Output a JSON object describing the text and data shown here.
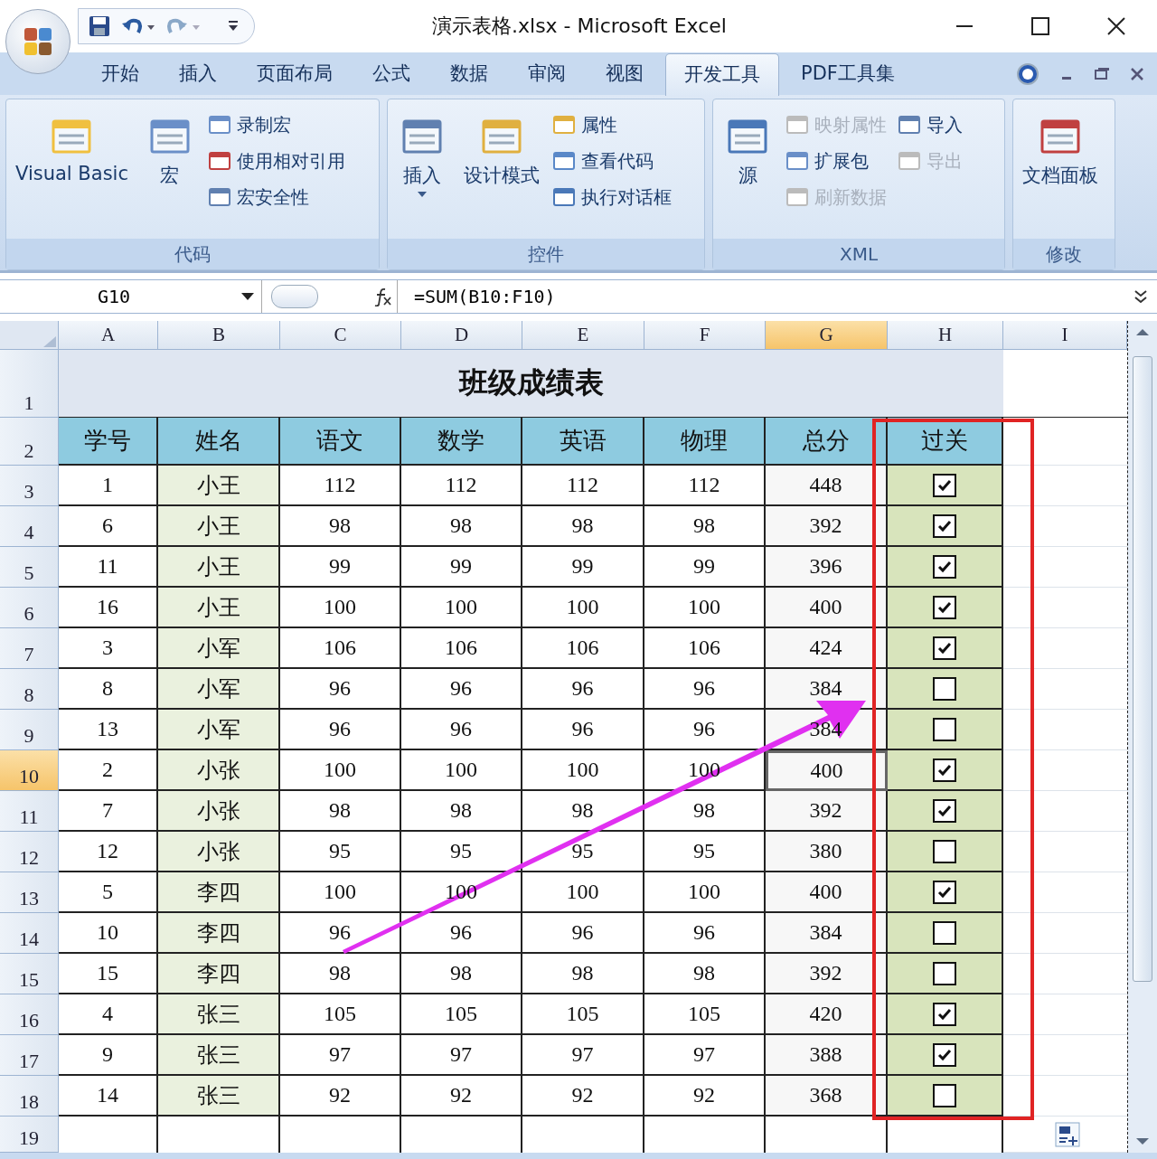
{
  "window": {
    "title": "演示表格.xlsx - Microsoft Excel"
  },
  "tabs": [
    {
      "label": "开始",
      "selected": false
    },
    {
      "label": "插入",
      "selected": false
    },
    {
      "label": "页面布局",
      "selected": false
    },
    {
      "label": "公式",
      "selected": false
    },
    {
      "label": "数据",
      "selected": false
    },
    {
      "label": "审阅",
      "selected": false
    },
    {
      "label": "视图",
      "selected": false
    },
    {
      "label": "开发工具",
      "selected": true
    },
    {
      "label": "PDF工具集",
      "selected": false
    }
  ],
  "ribbon_groups": [
    {
      "label": "代码",
      "large": [
        {
          "label": "Visual Basic",
          "dropdown": false
        },
        {
          "label": "宏",
          "dropdown": false
        }
      ],
      "small": [
        {
          "label": "录制宏",
          "disabled": false
        },
        {
          "label": "使用相对引用",
          "disabled": false
        },
        {
          "label": "宏安全性",
          "disabled": false
        }
      ]
    },
    {
      "label": "控件",
      "large": [
        {
          "label": "插入",
          "dropdown": true
        },
        {
          "label": "设计模式",
          "dropdown": false
        }
      ],
      "small": [
        {
          "label": "属性",
          "disabled": false
        },
        {
          "label": "查看代码",
          "disabled": false
        },
        {
          "label": "执行对话框",
          "disabled": false
        }
      ]
    },
    {
      "label": "XML",
      "large": [
        {
          "label": "源",
          "dropdown": false
        }
      ],
      "small": [
        {
          "label": "映射属性",
          "disabled": true
        },
        {
          "label": "扩展包",
          "disabled": false
        },
        {
          "label": "刷新数据",
          "disabled": true
        },
        {
          "label": "导入",
          "disabled": false
        },
        {
          "label": "导出",
          "disabled": true
        }
      ]
    },
    {
      "label": "修改",
      "large": [
        {
          "label": "文档面板",
          "dropdown": false
        }
      ]
    }
  ],
  "name_box": "G10",
  "formula": "=SUM(B10:F10)",
  "columns": [
    {
      "label": "A",
      "selected": false
    },
    {
      "label": "B",
      "selected": false
    },
    {
      "label": "C",
      "selected": false
    },
    {
      "label": "D",
      "selected": false
    },
    {
      "label": "E",
      "selected": false
    },
    {
      "label": "F",
      "selected": false
    },
    {
      "label": "G",
      "selected": true
    },
    {
      "label": "H",
      "selected": false
    },
    {
      "label": "I",
      "selected": false
    }
  ],
  "sheet_title": "班级成绩表",
  "table_headers": [
    "学号",
    "姓名",
    "语文",
    "数学",
    "英语",
    "物理",
    "总分",
    "过关"
  ],
  "rows": [
    {
      "row": "3",
      "selected": false,
      "cells": [
        "1",
        "小王",
        "112",
        "112",
        "112",
        "112",
        "448"
      ],
      "passed": true
    },
    {
      "row": "4",
      "selected": false,
      "cells": [
        "6",
        "小王",
        "98",
        "98",
        "98",
        "98",
        "392"
      ],
      "passed": true
    },
    {
      "row": "5",
      "selected": false,
      "cells": [
        "11",
        "小王",
        "99",
        "99",
        "99",
        "99",
        "396"
      ],
      "passed": true
    },
    {
      "row": "6",
      "selected": false,
      "cells": [
        "16",
        "小王",
        "100",
        "100",
        "100",
        "100",
        "400"
      ],
      "passed": true
    },
    {
      "row": "7",
      "selected": false,
      "cells": [
        "3",
        "小军",
        "106",
        "106",
        "106",
        "106",
        "424"
      ],
      "passed": true
    },
    {
      "row": "8",
      "selected": false,
      "cells": [
        "8",
        "小军",
        "96",
        "96",
        "96",
        "96",
        "384"
      ],
      "passed": false
    },
    {
      "row": "9",
      "selected": false,
      "cells": [
        "13",
        "小军",
        "96",
        "96",
        "96",
        "96",
        "384"
      ],
      "passed": false
    },
    {
      "row": "10",
      "selected": true,
      "cells": [
        "2",
        "小张",
        "100",
        "100",
        "100",
        "100",
        "400"
      ],
      "passed": true
    },
    {
      "row": "11",
      "selected": false,
      "cells": [
        "7",
        "小张",
        "98",
        "98",
        "98",
        "98",
        "392"
      ],
      "passed": true
    },
    {
      "row": "12",
      "selected": false,
      "cells": [
        "12",
        "小张",
        "95",
        "95",
        "95",
        "95",
        "380"
      ],
      "passed": false
    },
    {
      "row": "13",
      "selected": false,
      "cells": [
        "5",
        "李四",
        "100",
        "100",
        "100",
        "100",
        "400"
      ],
      "passed": true
    },
    {
      "row": "14",
      "selected": false,
      "cells": [
        "10",
        "李四",
        "96",
        "96",
        "96",
        "96",
        "384"
      ],
      "passed": false
    },
    {
      "row": "15",
      "selected": false,
      "cells": [
        "15",
        "李四",
        "98",
        "98",
        "98",
        "98",
        "392"
      ],
      "passed": false
    },
    {
      "row": "16",
      "selected": false,
      "cells": [
        "4",
        "张三",
        "105",
        "105",
        "105",
        "105",
        "420"
      ],
      "passed": true
    },
    {
      "row": "17",
      "selected": false,
      "cells": [
        "9",
        "张三",
        "97",
        "97",
        "97",
        "97",
        "388"
      ],
      "passed": true
    },
    {
      "row": "18",
      "selected": false,
      "cells": [
        "14",
        "张三",
        "92",
        "92",
        "92",
        "92",
        "368"
      ],
      "passed": false
    }
  ],
  "row_labels": {
    "title_row": "1",
    "header_row": "2",
    "last_row": "19"
  }
}
